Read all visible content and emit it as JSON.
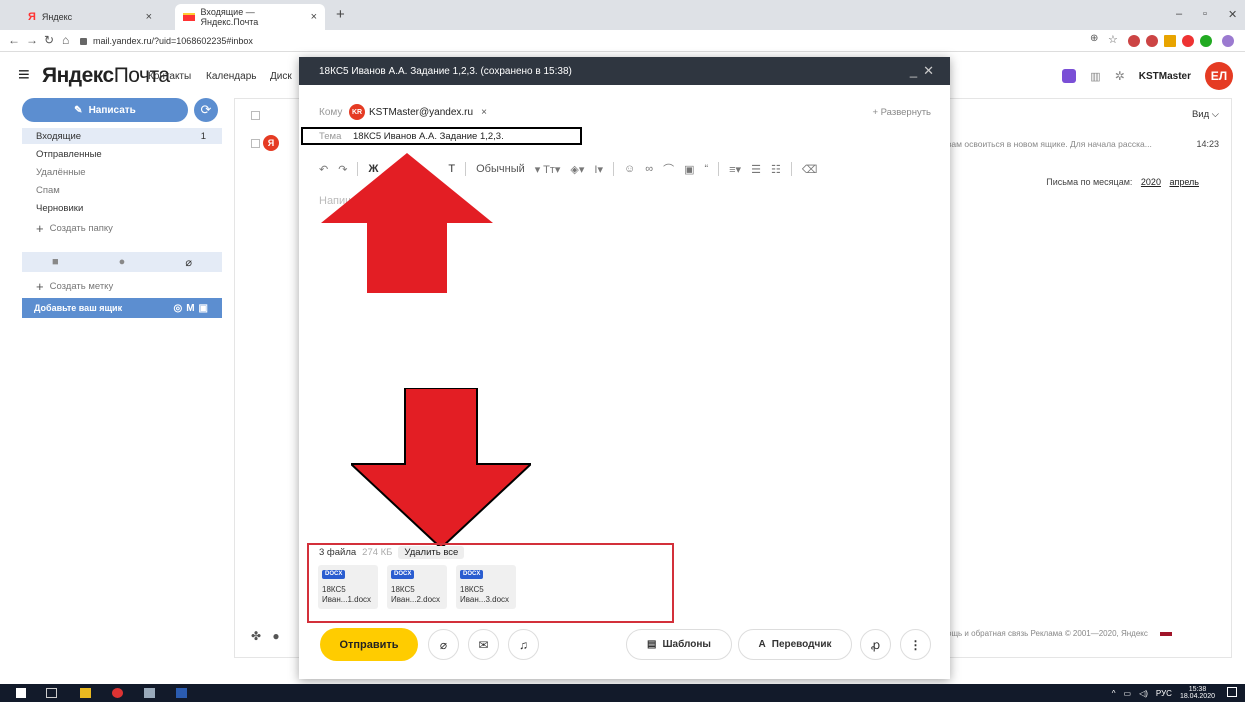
{
  "browser": {
    "tabs": [
      {
        "title": "Яндекс",
        "favicon": "Я"
      },
      {
        "title": "Входящие — Яндекс.Почта"
      }
    ],
    "new_tab": "+",
    "url": "mail.yandex.ru/?uid=1068602235#inbox"
  },
  "header": {
    "logo_bold": "Яндекс",
    "logo_light": "Почта",
    "nav": [
      "Контакты",
      "Календарь",
      "Диск"
    ],
    "username": "KSTMaster",
    "avatar_initials": "ЕЛ"
  },
  "sidebar": {
    "compose_label": "Написать",
    "folders": [
      {
        "name": "Входящие",
        "count": "1"
      },
      {
        "name": "Отправленные"
      },
      {
        "name": "Удалённые"
      },
      {
        "name": "Спам"
      },
      {
        "name": "Черновики"
      }
    ],
    "create_folder": "Создать папку",
    "create_label": "Создать метку",
    "add_mailbox": "Добавьте ваш ящик"
  },
  "list": {
    "view_label": "Вид",
    "message_snippet": "вам освоиться в новом ящике. Для начала расска...",
    "message_time": "14:23",
    "months_label": "Письма по месяцам:",
    "months_year": "2020",
    "months_month": "апрель",
    "footer": "ощь и обратная связь   Реклама   © 2001—2020, Яндекс"
  },
  "compose": {
    "title": "18КС5 Иванов А.А. Задание 1,2,3. (сохранено в 15:38)",
    "to_label": "Кому",
    "recipient_initials": "KR",
    "recipient": "KSTMaster@yandex.ru",
    "expand_label": "Развернуть",
    "subject_label": "Тема",
    "subject": "18КС5 Иванов А.А. Задание 1,2,3.",
    "toolbar": {
      "bold": "Ж",
      "strike": "Т",
      "style": "Обычный"
    },
    "body_placeholder": "Напишите",
    "attachments": {
      "count_label": "3 файла",
      "size": "274 КБ",
      "delete_all": "Удалить все",
      "files": [
        {
          "badge": "DOCX",
          "line1": "18КС5",
          "line2": "Иван...1.docx"
        },
        {
          "badge": "DOCX",
          "line1": "18КС5",
          "line2": "Иван...2.docx"
        },
        {
          "badge": "DOCX",
          "line1": "18КС5",
          "line2": "Иван...3.docx"
        }
      ]
    },
    "send_label": "Отправить",
    "templates_label": "Шаблоны",
    "translator_label": "Переводчик"
  },
  "taskbar": {
    "lang": "РУС",
    "time": "15:38",
    "date": "18.04.2020"
  },
  "colors": {
    "yandex_red": "#e53b23",
    "send_yellow": "#ffcc00",
    "compose_blue": "#5c8ed0",
    "title_dark": "#2f3640",
    "annotation_red": "#e31e24"
  }
}
